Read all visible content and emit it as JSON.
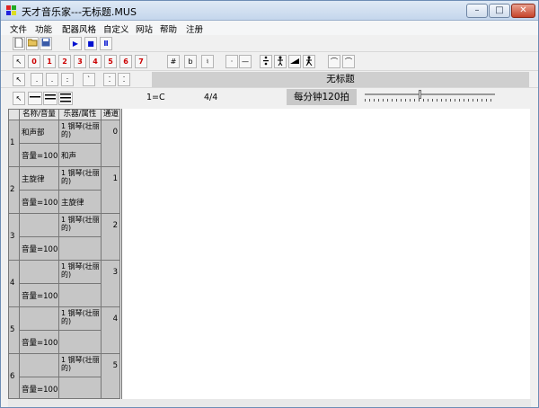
{
  "window": {
    "title": "天才音乐家---无标题.MUS",
    "minimize": "–",
    "maximize": "□",
    "close": "✕"
  },
  "menu": [
    "文件",
    "功能",
    "配器风格",
    "自定义",
    "网站",
    "帮助",
    "注册"
  ],
  "toolbar1": {
    "new": "new-file-icon",
    "open": "open-folder-icon",
    "save": "save-icon",
    "play": "▶",
    "stop": "■",
    "pause": "Ⅱ"
  },
  "toolbar2": {
    "arrow": "↖",
    "notes": [
      "0",
      "1",
      "2",
      "3",
      "4",
      "5",
      "6",
      "7"
    ],
    "sharp": "#",
    "flat": "b",
    "natural": "♮",
    "dot": "·",
    "dash": "—",
    "tie1": "⌒",
    "tie2": "⌒"
  },
  "toolbar3": {
    "arrow": "↖",
    "dots": [
      ".",
      ".",
      ":",
      "`",
      "⁚",
      "⁚"
    ]
  },
  "score_title": "无标题",
  "row4": {
    "arrow": "↖",
    "key": "1=C",
    "time": "4/4",
    "tempo": "每分钟120拍"
  },
  "grid": {
    "headers": [
      "名称/音量",
      "乐器/属性",
      "通道"
    ],
    "tracks": [
      {
        "no": "1",
        "name": "和声部",
        "volume": "音量=100",
        "instrument": "1 钢琴(壮丽的)",
        "property": "和声",
        "channel": "0"
      },
      {
        "no": "2",
        "name": "主旋律",
        "volume": "音量=100",
        "instrument": "1 钢琴(壮丽的)",
        "property": "主旋律",
        "channel": "1"
      },
      {
        "no": "3",
        "name": "",
        "volume": "音量=100",
        "instrument": "1 钢琴(壮丽的)",
        "property": "",
        "channel": "2"
      },
      {
        "no": "4",
        "name": "",
        "volume": "音量=100",
        "instrument": "1 钢琴(壮丽的)",
        "property": "",
        "channel": "3"
      },
      {
        "no": "5",
        "name": "",
        "volume": "音量=100",
        "instrument": "1 钢琴(壮丽的)",
        "property": "",
        "channel": "4"
      },
      {
        "no": "6",
        "name": "",
        "volume": "音量=100",
        "instrument": "1 钢琴(壮丽的)",
        "property": "",
        "channel": "5"
      }
    ]
  },
  "colors": {
    "red_notes": "#cc0000",
    "play_blue": "#0010d0"
  }
}
